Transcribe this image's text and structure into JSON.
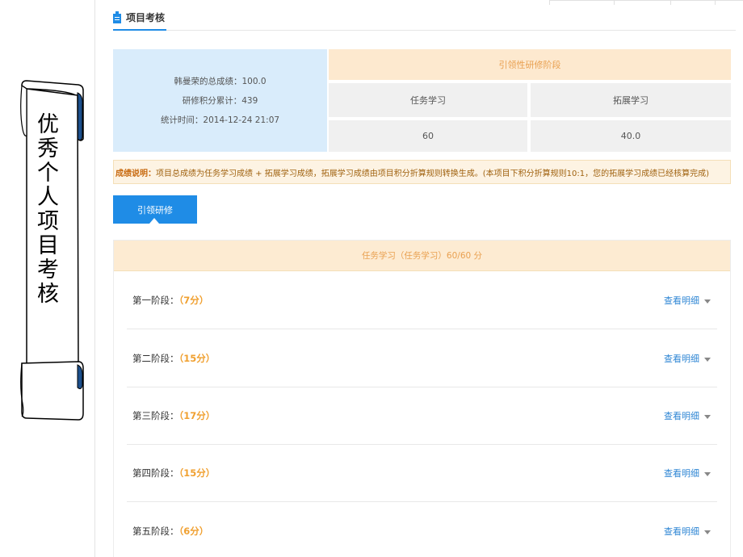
{
  "scroll": {
    "title": "优秀个人　项目考核"
  },
  "header": {
    "title": "项目考核"
  },
  "summary": {
    "total": "韩曼荣的总成绩：100.0",
    "credits": "研修积分累计：439",
    "time": "统计时间：2014-12-24 21:07"
  },
  "stage_table": {
    "stage_name": "引领性研修阶段",
    "col_task": "任务学习",
    "col_ext": "拓展学习",
    "val_task": "60",
    "val_ext": "40.0"
  },
  "note": {
    "label": "成绩说明：",
    "text": "项目总成绩为任务学习成绩 + 拓展学习成绩，拓展学习成绩由项目积分折算规则转换生成。(本项目下积分折算规则10:1，您的拓展学习成绩已经核算完成)"
  },
  "lead_button": "引领研修",
  "task_section": {
    "header": "任务学习（任务学习）60/60 分",
    "detail_label": "查看明细",
    "stages": [
      {
        "label": "第一阶段：",
        "score": "（7分）"
      },
      {
        "label": "第二阶段：",
        "score": "（15分）"
      },
      {
        "label": "第三阶段：",
        "score": "（17分）"
      },
      {
        "label": "第四阶段：",
        "score": "（15分）"
      },
      {
        "label": "第五阶段：",
        "score": "（6分）"
      }
    ]
  },
  "colors": {
    "accent": "#1f8ce6",
    "orange": "#f0a030",
    "summary_bg": "#d9ecfb"
  }
}
